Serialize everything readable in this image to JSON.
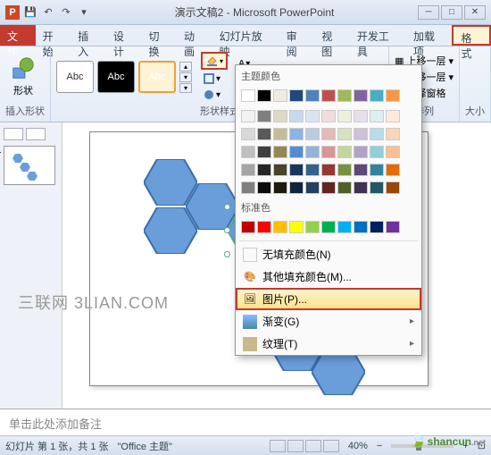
{
  "title": "演示文稿2 - Microsoft PowerPoint",
  "tabs": {
    "file": "文件",
    "home": "开始",
    "insert": "插入",
    "design": "设计",
    "transitions": "切换",
    "animations": "动画",
    "slideshow": "幻灯片放映",
    "review": "审阅",
    "view": "视图",
    "developer": "开发工具",
    "addins": "加载项",
    "format": "格式"
  },
  "ribbon": {
    "shapes_group": "插入形状",
    "shapes_label": "形状",
    "styles_group": "形状样式",
    "arrange_group": "排列",
    "size_group": "大小",
    "abc": "Abc",
    "bring_forward": "上移一层",
    "send_backward": "下移一层",
    "selection_pane": "选择窗格"
  },
  "dropdown": {
    "theme_colors": "主题颜色",
    "standard_colors": "标准色",
    "no_fill": "无填充颜色(N)",
    "more_colors": "其他填充颜色(M)...",
    "picture": "图片(P)...",
    "gradient": "渐变(G)",
    "texture": "纹理(T)"
  },
  "theme_colors_row1": [
    "#ffffff",
    "#000000",
    "#eeece1",
    "#1f497d",
    "#4f81bd",
    "#c0504d",
    "#9bbb59",
    "#8064a2",
    "#4bacc6",
    "#f79646"
  ],
  "theme_colors_rows": [
    [
      "#f2f2f2",
      "#7f7f7f",
      "#ddd9c3",
      "#c6d9f0",
      "#dbe5f1",
      "#f2dcdb",
      "#ebf1dd",
      "#e5e0ec",
      "#dbeef3",
      "#fdeada"
    ],
    [
      "#d8d8d8",
      "#595959",
      "#c4bd97",
      "#8db3e2",
      "#b8cce4",
      "#e5b9b7",
      "#d7e3bc",
      "#ccc1d9",
      "#b7dde8",
      "#fbd5b5"
    ],
    [
      "#bfbfbf",
      "#3f3f3f",
      "#938953",
      "#548dd4",
      "#95b3d7",
      "#d99694",
      "#c3d69b",
      "#b2a2c7",
      "#92cddc",
      "#fac08f"
    ],
    [
      "#a5a5a5",
      "#262626",
      "#494429",
      "#17365d",
      "#366092",
      "#953734",
      "#76923c",
      "#5f497a",
      "#31859b",
      "#e36c09"
    ],
    [
      "#7f7f7f",
      "#0c0c0c",
      "#1d1b10",
      "#0f243e",
      "#244061",
      "#632423",
      "#4f6128",
      "#3f3151",
      "#205867",
      "#974806"
    ]
  ],
  "standard_colors": [
    "#c00000",
    "#ff0000",
    "#ffc000",
    "#ffff00",
    "#92d050",
    "#00b050",
    "#00b0f0",
    "#0070c0",
    "#002060",
    "#7030a0"
  ],
  "notes": "单击此处添加备注",
  "status": {
    "slide": "幻灯片 第 1 张，共 1 张",
    "theme": "\"Office 主题\"",
    "lang": "",
    "zoom": "40%"
  },
  "watermark": "三联网 3LIAN.COM",
  "logo": "shancun",
  "logo_sub": ".net"
}
